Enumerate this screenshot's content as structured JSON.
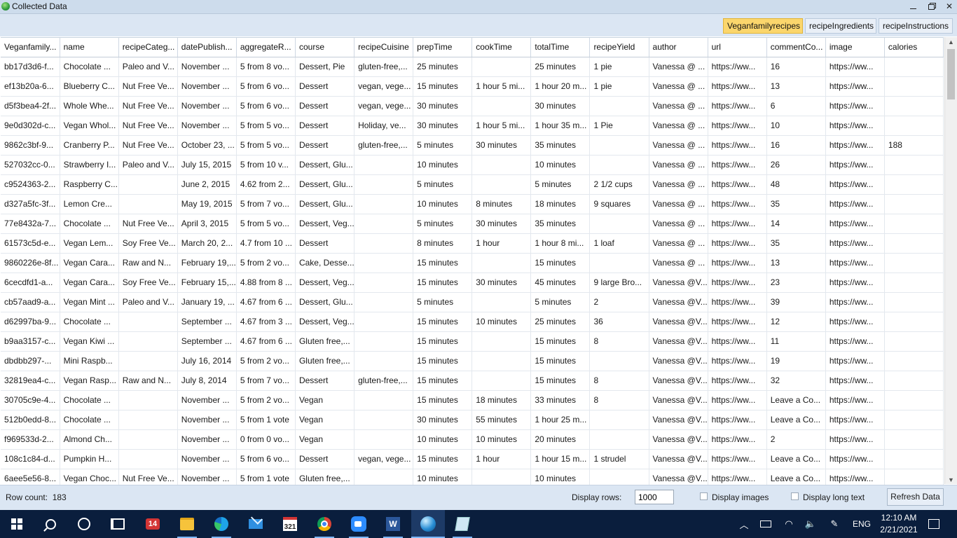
{
  "window": {
    "title": "Collected Data"
  },
  "tabs": [
    {
      "label": "Veganfamilyrecipes",
      "active": true
    },
    {
      "label": "recipeIngredients",
      "active": false
    },
    {
      "label": "recipeInstructions",
      "active": false
    }
  ],
  "grid": {
    "columns": [
      "Veganfamily...",
      "name",
      "recipeCateg...",
      "datePublish...",
      "aggregateR...",
      "course",
      "recipeCuisine",
      "prepTime",
      "cookTime",
      "totalTime",
      "recipeYield",
      "author",
      "url",
      "commentCo...",
      "image",
      "calories"
    ],
    "rows": [
      [
        "bb17d3d6-f...",
        "Chocolate ...",
        "Paleo and V...",
        "November ...",
        "5 from 8 vo...",
        "Dessert, Pie",
        "gluten-free,...",
        "25 minutes",
        "",
        "25 minutes",
        "1 pie",
        "Vanessa @ ...",
        "https://ww...",
        "16",
        "https://ww...",
        ""
      ],
      [
        "ef13b20a-6...",
        "Blueberry C...",
        "Nut Free Ve...",
        "November ...",
        "5 from 6 vo...",
        "Dessert",
        "vegan, vege...",
        "15 minutes",
        "1 hour 5 mi...",
        "1 hour 20 m...",
        "1 pie",
        "Vanessa @ ...",
        "https://ww...",
        "13",
        "https://ww...",
        ""
      ],
      [
        "d5f3bea4-2f...",
        "Whole Whe...",
        "Nut Free Ve...",
        "November ...",
        "5 from 6 vo...",
        "Dessert",
        "vegan, vege...",
        "30 minutes",
        "",
        "30 minutes",
        "",
        "Vanessa @ ...",
        "https://ww...",
        "6",
        "https://ww...",
        ""
      ],
      [
        "9e0d302d-c...",
        "Vegan Whol...",
        "Nut Free Ve...",
        "November ...",
        "5 from 5 vo...",
        "Dessert",
        "Holiday, ve...",
        "30 minutes",
        "1 hour 5 mi...",
        "1 hour 35 m...",
        "1 Pie",
        "Vanessa @ ...",
        "https://ww...",
        "10",
        "https://ww...",
        ""
      ],
      [
        "9862c3bf-9...",
        "Cranberry P...",
        "Nut Free Ve...",
        "October 23, ...",
        "5 from 5 vo...",
        "Dessert",
        "gluten-free,...",
        "5 minutes",
        "30 minutes",
        "35 minutes",
        "",
        "Vanessa @ ...",
        "https://ww...",
        "16",
        "https://ww...",
        "188"
      ],
      [
        "527032cc-0...",
        "Strawberry I...",
        "Paleo and V...",
        "July 15, 2015",
        "5 from 10 v...",
        "Dessert, Glu...",
        "",
        "10 minutes",
        "",
        "10 minutes",
        "",
        "Vanessa @ ...",
        "https://ww...",
        "26",
        "https://ww...",
        ""
      ],
      [
        "c9524363-2...",
        "Raspberry C...",
        "",
        "June 2, 2015",
        "4.62 from 2...",
        "Dessert, Glu...",
        "",
        "5 minutes",
        "",
        "5 minutes",
        "2 1/2 cups",
        "Vanessa @ ...",
        "https://ww...",
        "48",
        "https://ww...",
        ""
      ],
      [
        "d327a5fc-3f...",
        "Lemon Cre...",
        "",
        "May 19, 2015",
        "5 from 7 vo...",
        "Dessert, Glu...",
        "",
        "10 minutes",
        "8 minutes",
        "18 minutes",
        "9 squares",
        "Vanessa @ ...",
        "https://ww...",
        "35",
        "https://ww...",
        ""
      ],
      [
        "77e8432a-7...",
        "Chocolate ...",
        "Nut Free Ve...",
        "April 3, 2015",
        "5 from 5 vo...",
        "Dessert, Veg...",
        "",
        "5 minutes",
        "30 minutes",
        "35 minutes",
        "",
        "Vanessa @ ...",
        "https://ww...",
        "14",
        "https://ww...",
        ""
      ],
      [
        "61573c5d-e...",
        "Vegan Lem...",
        "Soy Free Ve...",
        "March 20, 2...",
        "4.7 from 10 ...",
        "Dessert",
        "",
        "8 minutes",
        "1 hour",
        "1 hour 8 mi...",
        "1 loaf",
        "Vanessa @ ...",
        "https://ww...",
        "35",
        "https://ww...",
        ""
      ],
      [
        "9860226e-8f...",
        "Vegan Cara...",
        "Raw and N...",
        "February 19,...",
        "5 from 2 vo...",
        "Cake, Desse...",
        "",
        "15 minutes",
        "",
        "15 minutes",
        "",
        "Vanessa @ ...",
        "https://ww...",
        "13",
        "https://ww...",
        ""
      ],
      [
        "6cecdfd1-a...",
        "Vegan Cara...",
        "Soy Free Ve...",
        "February 15,...",
        "4.88 from 8 ...",
        "Dessert, Veg...",
        "",
        "15 minutes",
        "30 minutes",
        "45 minutes",
        "9 large Bro...",
        "Vanessa @V...",
        "https://ww...",
        "23",
        "https://ww...",
        ""
      ],
      [
        "cb57aad9-a...",
        "Vegan Mint ...",
        "Paleo and V...",
        "January 19, ...",
        "4.67 from 6 ...",
        "Dessert, Glu...",
        "",
        "5 minutes",
        "",
        "5 minutes",
        "2",
        "Vanessa @V...",
        "https://ww...",
        "39",
        "https://ww...",
        ""
      ],
      [
        "d62997ba-9...",
        "Chocolate ...",
        "",
        "September ...",
        "4.67 from 3 ...",
        "Dessert, Veg...",
        "",
        "15 minutes",
        "10 minutes",
        "25 minutes",
        "36",
        "Vanessa @V...",
        "https://ww...",
        "12",
        "https://ww...",
        ""
      ],
      [
        "b9aa3157-c...",
        "Vegan Kiwi ...",
        "",
        "September ...",
        "4.67 from 6 ...",
        "Gluten free,...",
        "",
        "15 minutes",
        "",
        "15 minutes",
        "8",
        "Vanessa @V...",
        "https://ww...",
        "11",
        "https://ww...",
        ""
      ],
      [
        "dbdbb297-...",
        "Mini Raspb...",
        "",
        "July 16, 2014",
        "5 from 2 vo...",
        "Gluten free,...",
        "",
        "15 minutes",
        "",
        "15 minutes",
        "",
        "Vanessa @V...",
        "https://ww...",
        "19",
        "https://ww...",
        ""
      ],
      [
        "32819ea4-c...",
        "Vegan Rasp...",
        "Raw and N...",
        "July 8, 2014",
        "5 from 7 vo...",
        "Dessert",
        "gluten-free,...",
        "15 minutes",
        "",
        "15 minutes",
        "8",
        "Vanessa @V...",
        "https://ww...",
        "32",
        "https://ww...",
        ""
      ],
      [
        "30705c9e-4...",
        "Chocolate ...",
        "",
        "November ...",
        "5 from 2 vo...",
        "Vegan",
        "",
        "15 minutes",
        "18 minutes",
        "33 minutes",
        "8",
        "Vanessa @V...",
        "https://ww...",
        "Leave a Co...",
        "https://ww...",
        ""
      ],
      [
        "512b0edd-8...",
        "Chocolate ...",
        "",
        "November ...",
        "5 from 1 vote",
        "Vegan",
        "",
        "30 minutes",
        "55 minutes",
        "1 hour 25 m...",
        "",
        "Vanessa @V...",
        "https://ww...",
        "Leave a Co...",
        "https://ww...",
        ""
      ],
      [
        "f969533d-2...",
        "Almond Ch...",
        "",
        "November ...",
        "0 from 0 vo...",
        "Vegan",
        "",
        "10 minutes",
        "10 minutes",
        "20 minutes",
        "",
        "Vanessa @V...",
        "https://ww...",
        "2",
        "https://ww...",
        ""
      ],
      [
        "108c1c84-d...",
        "Pumpkin H...",
        "",
        "November ...",
        "5 from 6 vo...",
        "Dessert",
        "vegan, vege...",
        "15 minutes",
        "1 hour",
        "1 hour 15 m...",
        "1 strudel",
        "Vanessa @V...",
        "https://ww...",
        "Leave a Co...",
        "https://ww...",
        ""
      ],
      [
        "6aee5e56-8...",
        "Vegan Choc...",
        "Nut Free Ve...",
        "November ...",
        "5 from 1 vote",
        "Gluten free,...",
        "",
        "10 minutes",
        "",
        "10 minutes",
        "",
        "Vanessa @V...",
        "https://ww...",
        "Leave a Co...",
        "https://ww...",
        ""
      ]
    ]
  },
  "status": {
    "row_count_label": "Row count:",
    "row_count": "183",
    "display_rows_label": "Display rows:",
    "display_rows_value": "1000",
    "display_images_label": "Display images",
    "display_long_text_label": "Display long text",
    "refresh_label": "Refresh Data"
  },
  "taskbar": {
    "badge_count": "14",
    "calendar_label": "321",
    "word_letter": "W",
    "lang": "ENG",
    "time": "12:10 AM",
    "date": "2/21/2021"
  },
  "colors": {
    "active_tab": "#fbd66c",
    "taskbar": "#0a1e3d",
    "chrome": "#dbe6f3"
  }
}
